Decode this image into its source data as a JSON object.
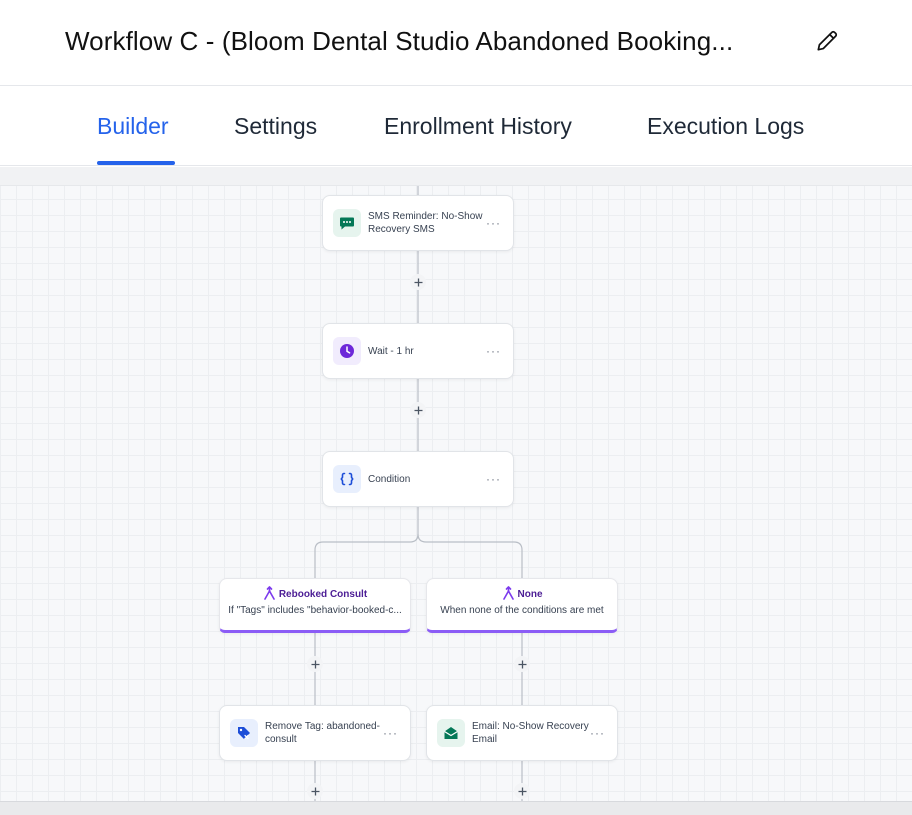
{
  "header": {
    "title": "Workflow C - (Bloom Dental Studio Abandoned Booking..."
  },
  "tabs": [
    {
      "label": "Builder",
      "active": true
    },
    {
      "label": "Settings",
      "active": false
    },
    {
      "label": "Enrollment History",
      "active": false
    },
    {
      "label": "Execution Logs",
      "active": false
    }
  ],
  "nodes": {
    "sms": {
      "label": "SMS Reminder: No-Show Recovery SMS",
      "icon": "chat-bubble-icon",
      "color": "#047857"
    },
    "wait": {
      "label": "Wait - 1 hr",
      "icon": "clock-icon",
      "color": "#6d28d9"
    },
    "condition": {
      "label": "Condition",
      "icon": "braces-icon",
      "color": "#1d4ed8"
    },
    "remove_tag": {
      "label": "Remove Tag: abandoned-consult",
      "icon": "tag-icon",
      "color": "#1d4ed8"
    },
    "email": {
      "label": "Email: No-Show Recovery Email",
      "icon": "envelope-icon",
      "color": "#047857"
    }
  },
  "branches": {
    "rebooked": {
      "title": "Rebooked Consult",
      "description": "If \"Tags\" includes \"behavior-booked-c..."
    },
    "none": {
      "title": "None",
      "description": "When none of the conditions are met"
    }
  },
  "more_label": "···",
  "plus_label": "+",
  "colors": {
    "accent": "#2563eb",
    "branch": "#8b5cf6"
  }
}
